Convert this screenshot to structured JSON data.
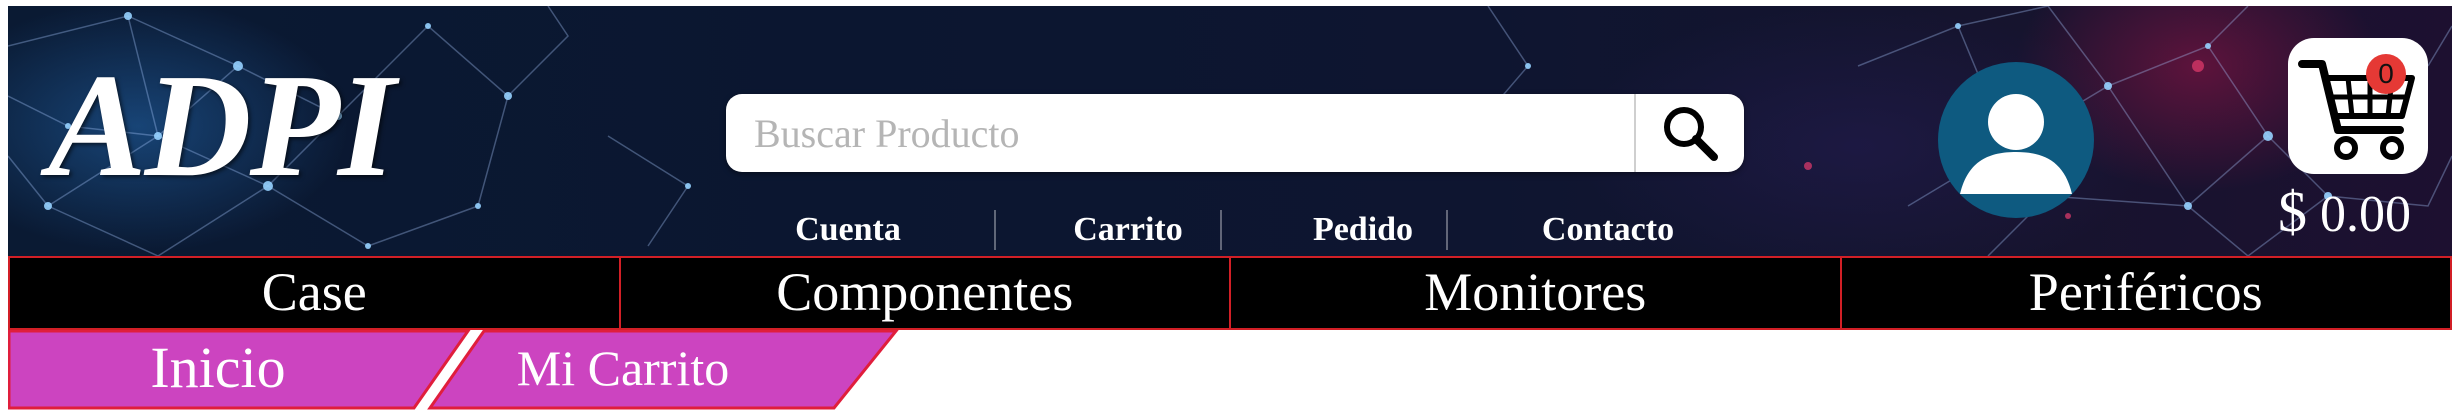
{
  "brand": {
    "logo_text": "ADPI"
  },
  "search": {
    "placeholder": "Buscar Producto",
    "value": ""
  },
  "nav_links": [
    "Cuenta",
    "Carrito",
    "Pedido",
    "Contacto"
  ],
  "cart": {
    "count": "0",
    "currency": "$",
    "total": "0.00"
  },
  "categories": [
    "Case",
    "Componentes",
    "Monitores",
    "Periféricos"
  ],
  "breadcrumb": [
    "Inicio",
    "Mi Carrito"
  ],
  "colors": {
    "category_bar": "#000000",
    "border_accent": "#d21f26",
    "tab_fill": "#cc44c0",
    "avatar": "#0e5a80",
    "badge": "#e53935"
  },
  "icons": [
    "search-icon",
    "user-avatar-icon",
    "shopping-cart-icon"
  ]
}
